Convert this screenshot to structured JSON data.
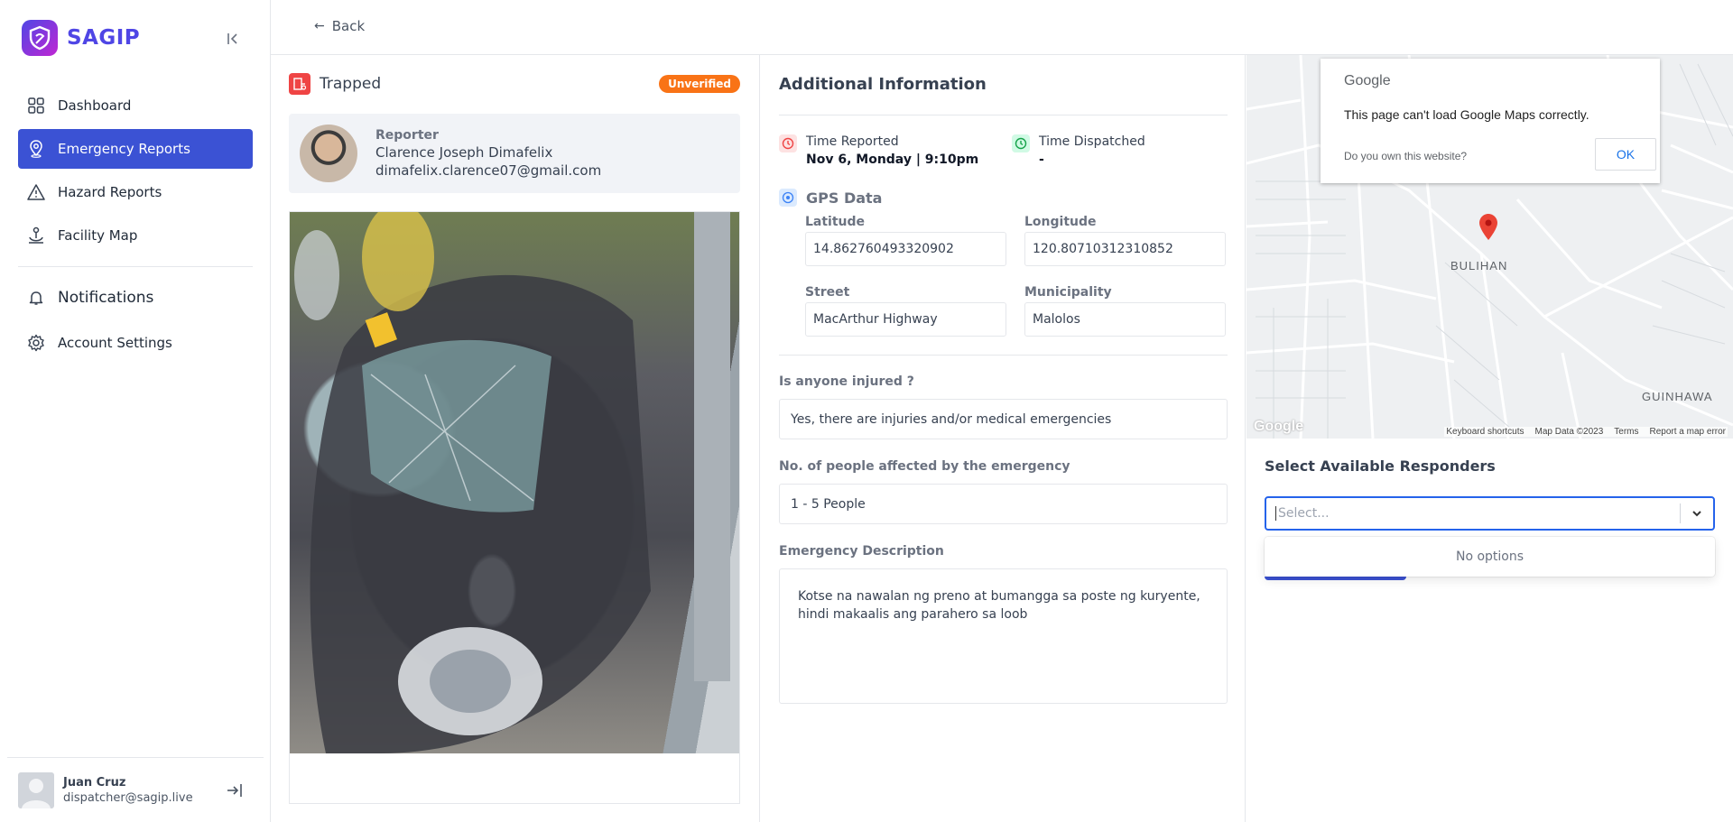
{
  "brand": {
    "name": "SAGIP"
  },
  "sidebar": {
    "items": [
      {
        "label": "Dashboard",
        "icon": "grid-icon"
      },
      {
        "label": "Emergency Reports",
        "icon": "location-pin-icon"
      },
      {
        "label": "Hazard Reports",
        "icon": "warning-icon"
      },
      {
        "label": "Facility Map",
        "icon": "anchor-icon"
      }
    ],
    "secondary": [
      {
        "label": "Notifications",
        "icon": "bell-icon"
      },
      {
        "label": "Account Settings",
        "icon": "gear-icon"
      }
    ],
    "user": {
      "name": "Juan Cruz",
      "email": "dispatcher@sagip.live"
    }
  },
  "topbar": {
    "back_label": "Back"
  },
  "report": {
    "type": "Trapped",
    "status": "Unverified",
    "reporter": {
      "title": "Reporter",
      "name": "Clarence Joseph Dimafelix",
      "email": "dimafelix.clarence07@gmail.com"
    }
  },
  "info": {
    "title": "Additional Information",
    "time_reported_label": "Time Reported",
    "time_reported_value": "Nov 6, Monday | 9:10pm",
    "time_dispatched_label": "Time Dispatched",
    "time_dispatched_value": "-",
    "gps_title": "GPS Data",
    "latitude_label": "Latitude",
    "latitude_value": "14.862760493320902",
    "longitude_label": "Longitude",
    "longitude_value": "120.80710312310852",
    "street_label": "Street",
    "street_value": "MacArthur Highway",
    "municipality_label": "Municipality",
    "municipality_value": "Malolos",
    "injured_label": "Is anyone injured ?",
    "injured_value": "Yes, there are injuries and/or medical emergencies",
    "affected_label": "No. of people affected by the emergency",
    "affected_value": "1 - 5 People",
    "description_label": "Emergency Description",
    "description_value": "Kotse na nawalan ng preno at bumangga sa poste ng kuryente, hindi makaalis ang parahero sa loob"
  },
  "map": {
    "dialog_brand": "Google",
    "dialog_message": "This page can't load Google Maps correctly.",
    "dialog_question": "Do you own this website?",
    "dialog_ok": "OK",
    "labels": {
      "bulihan": "BULIHAN",
      "guinhawa": "GUINHAWA"
    },
    "footer": [
      "Keyboard shortcuts",
      "Map Data ©2023",
      "Terms",
      "Report a map error"
    ],
    "logo": "Google"
  },
  "responders": {
    "title": "Select Available Responders",
    "placeholder": "Select...",
    "no_options": "No options"
  },
  "colors": {
    "accent": "#3b52d4",
    "badge": "#f97316",
    "focus": "#2563eb"
  }
}
